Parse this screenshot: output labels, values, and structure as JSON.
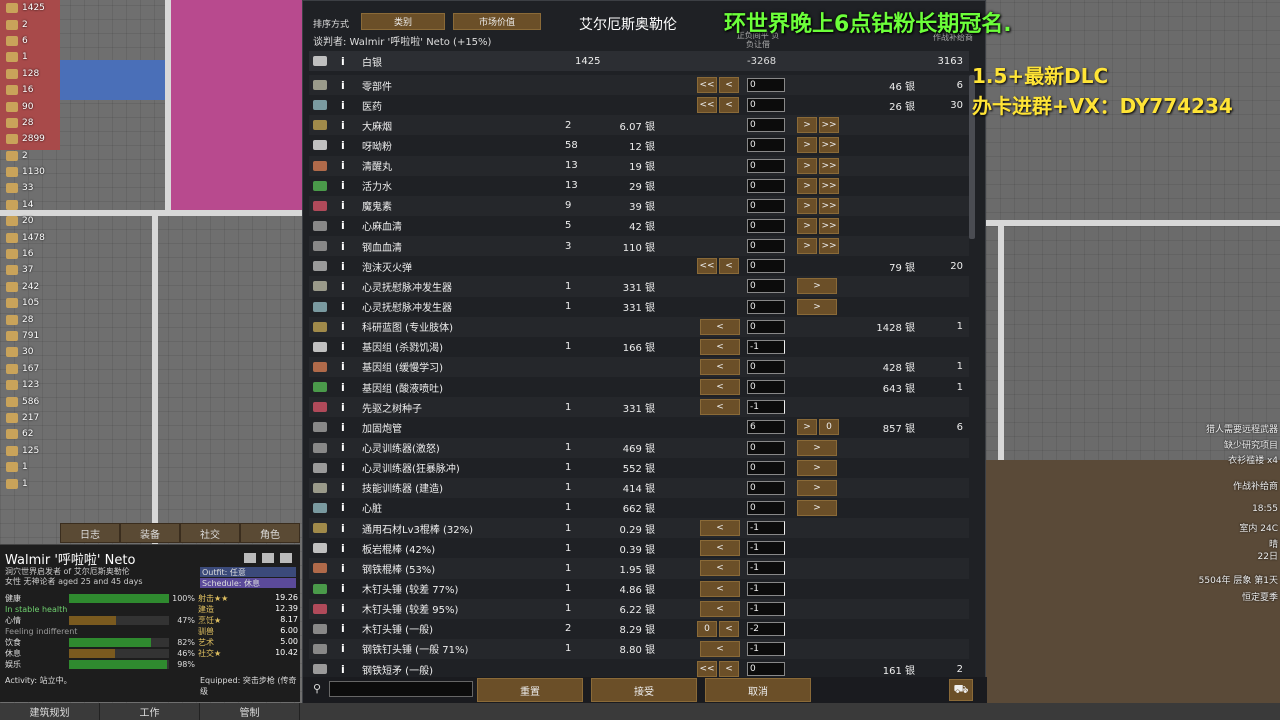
{
  "overlay": {
    "title": "环世界晚上6点钻粉长期冠名.",
    "line1": "1.5+最新DLC",
    "line2": "办卡进群+VX：DY774234"
  },
  "resources": [
    "1425",
    "2",
    "6",
    "1",
    "128",
    "16",
    "90",
    "28",
    "2899",
    "2",
    "1130",
    "33",
    "14",
    "20",
    "1478",
    "16",
    "37",
    "242",
    "105",
    "28",
    "791",
    "30",
    "167",
    "123",
    "586",
    "217",
    "62",
    "125",
    "1",
    "1"
  ],
  "dialog": {
    "sort_label": "排序方式",
    "sort_btn_1": "类别",
    "sort_btn_2": "市场价值",
    "trader_title": "艾尔厄斯奥勒伦",
    "negotiator": "谈判者: Walmir '呼啦啦' Neto (+15%)",
    "col_head_1": "正负间平 负负让借",
    "col_head_2": "作战补给商",
    "silver": {
      "name": "白银",
      "count": "1425",
      "offer": "-3268",
      "trader": "3163"
    },
    "rows": [
      {
        "name": "零部件",
        "count": "",
        "price": "",
        "lbtns": [
          "<<",
          "<"
        ],
        "input": "0",
        "neg": false,
        "rbtns": [],
        "tprice": "46 银",
        "tcount": "6"
      },
      {
        "name": "医药",
        "count": "",
        "price": "",
        "lbtns": [
          "<<",
          "<"
        ],
        "input": "0",
        "neg": false,
        "rbtns": [],
        "tprice": "26 银",
        "tcount": "30"
      },
      {
        "name": "大麻烟",
        "count": "2",
        "price": "6.07 银",
        "lbtns": [],
        "input": "0",
        "neg": false,
        "rbtns": [
          ">",
          ">>"
        ],
        "tprice": "",
        "tcount": ""
      },
      {
        "name": "呀呦粉",
        "count": "58",
        "price": "12 银",
        "lbtns": [],
        "input": "0",
        "neg": false,
        "rbtns": [
          ">",
          ">>"
        ],
        "tprice": "",
        "tcount": ""
      },
      {
        "name": "清醒丸",
        "count": "13",
        "price": "19 银",
        "lbtns": [],
        "input": "0",
        "neg": false,
        "rbtns": [
          ">",
          ">>"
        ],
        "tprice": "",
        "tcount": ""
      },
      {
        "name": "活力水",
        "count": "13",
        "price": "29 银",
        "lbtns": [],
        "input": "0",
        "neg": false,
        "rbtns": [
          ">",
          ">>"
        ],
        "tprice": "",
        "tcount": ""
      },
      {
        "name": "魔鬼素",
        "count": "9",
        "price": "39 银",
        "lbtns": [],
        "input": "0",
        "neg": false,
        "rbtns": [
          ">",
          ">>"
        ],
        "tprice": "",
        "tcount": ""
      },
      {
        "name": "心麻血清",
        "count": "5",
        "price": "42 银",
        "lbtns": [],
        "input": "0",
        "neg": false,
        "rbtns": [
          ">",
          ">>"
        ],
        "tprice": "",
        "tcount": ""
      },
      {
        "name": "钢血血清",
        "count": "3",
        "price": "110 银",
        "lbtns": [],
        "input": "0",
        "neg": false,
        "rbtns": [
          ">",
          ">>"
        ],
        "tprice": "",
        "tcount": ""
      },
      {
        "name": "泡沫灭火弹",
        "count": "",
        "price": "",
        "lbtns": [
          "<<",
          "<"
        ],
        "input": "0",
        "neg": false,
        "rbtns": [],
        "tprice": "79 银",
        "tcount": "20"
      },
      {
        "name": "心灵抚慰脉冲发生器",
        "count": "1",
        "price": "331 银",
        "lbtns": [],
        "input": "0",
        "neg": false,
        "rbtns": [
          ">"
        ],
        "tprice": "",
        "tcount": ""
      },
      {
        "name": "心灵抚慰脉冲发生器",
        "count": "1",
        "price": "331 银",
        "lbtns": [],
        "input": "0",
        "neg": false,
        "rbtns": [
          ">"
        ],
        "tprice": "",
        "tcount": ""
      },
      {
        "name": "科研蓝图 (专业肢体)",
        "count": "",
        "price": "",
        "lbtns": [
          "<"
        ],
        "input": "0",
        "neg": false,
        "rbtns": [],
        "tprice": "1428 银",
        "tcount": "1"
      },
      {
        "name": "基因组 (杀戮饥渴)",
        "count": "1",
        "price": "166 银",
        "lbtns": [
          "<"
        ],
        "input": "-1",
        "neg": true,
        "rbtns": [],
        "tprice": "",
        "tcount": ""
      },
      {
        "name": "基因组 (缓慢学习)",
        "count": "",
        "price": "",
        "lbtns": [
          "<"
        ],
        "input": "0",
        "neg": false,
        "rbtns": [],
        "tprice": "428 银",
        "tcount": "1"
      },
      {
        "name": "基因组 (酸液喷吐)",
        "count": "",
        "price": "",
        "lbtns": [
          "<"
        ],
        "input": "0",
        "neg": false,
        "rbtns": [],
        "tprice": "643 银",
        "tcount": "1"
      },
      {
        "name": "先驱之树种子",
        "count": "1",
        "price": "331 银",
        "lbtns": [
          "<"
        ],
        "input": "-1",
        "neg": true,
        "rbtns": [],
        "tprice": "",
        "tcount": ""
      },
      {
        "name": "加固炮管",
        "count": "",
        "price": "",
        "lbtns": [],
        "input": "6",
        "neg": false,
        "rbtns": [
          ">",
          "0"
        ],
        "tprice": "857 银",
        "tcount": "6"
      },
      {
        "name": "心灵训练器(激怒)",
        "count": "1",
        "price": "469 银",
        "lbtns": [],
        "input": "0",
        "neg": false,
        "rbtns": [
          ">"
        ],
        "tprice": "",
        "tcount": ""
      },
      {
        "name": "心灵训练器(狂暴脉冲)",
        "count": "1",
        "price": "552 银",
        "lbtns": [],
        "input": "0",
        "neg": false,
        "rbtns": [
          ">"
        ],
        "tprice": "",
        "tcount": ""
      },
      {
        "name": "技能训练器 (建造)",
        "count": "1",
        "price": "414 银",
        "lbtns": [],
        "input": "0",
        "neg": false,
        "rbtns": [
          ">"
        ],
        "tprice": "",
        "tcount": ""
      },
      {
        "name": "心脏",
        "count": "1",
        "price": "662 银",
        "lbtns": [],
        "input": "0",
        "neg": false,
        "rbtns": [
          ">"
        ],
        "tprice": "",
        "tcount": ""
      },
      {
        "name": "通用石材Lv3棍棒 (32%)",
        "count": "1",
        "price": "0.29 银",
        "lbtns": [
          "<"
        ],
        "input": "-1",
        "neg": true,
        "rbtns": [],
        "tprice": "",
        "tcount": ""
      },
      {
        "name": "板岩棍棒 (42%)",
        "count": "1",
        "price": "0.39 银",
        "lbtns": [
          "<"
        ],
        "input": "-1",
        "neg": true,
        "rbtns": [],
        "tprice": "",
        "tcount": ""
      },
      {
        "name": "钢铁棍棒 (53%)",
        "count": "1",
        "price": "1.95 银",
        "lbtns": [
          "<"
        ],
        "input": "-1",
        "neg": true,
        "rbtns": [],
        "tprice": "",
        "tcount": ""
      },
      {
        "name": "木钉头锤 (较差 77%)",
        "count": "1",
        "price": "4.86 银",
        "lbtns": [
          "<"
        ],
        "input": "-1",
        "neg": true,
        "rbtns": [],
        "tprice": "",
        "tcount": ""
      },
      {
        "name": "木钉头锤 (较差 95%)",
        "count": "1",
        "price": "6.22 银",
        "lbtns": [
          "<"
        ],
        "input": "-1",
        "neg": true,
        "rbtns": [],
        "tprice": "",
        "tcount": ""
      },
      {
        "name": "木钉头锤 (一般)",
        "count": "2",
        "price": "8.29 银",
        "lbtns": [
          "0",
          "<"
        ],
        "input": "-2",
        "neg": true,
        "rbtns": [],
        "tprice": "",
        "tcount": ""
      },
      {
        "name": "钢铁钉头锤 (一般 71%)",
        "count": "1",
        "price": "8.80 银",
        "lbtns": [
          "<"
        ],
        "input": "-1",
        "neg": true,
        "rbtns": [],
        "tprice": "",
        "tcount": ""
      },
      {
        "name": "钢铁短矛 (一般)",
        "count": "",
        "price": "",
        "lbtns": [
          "<<",
          "<"
        ],
        "input": "0",
        "neg": false,
        "rbtns": [],
        "tprice": "161 银",
        "tcount": "2"
      }
    ],
    "footer": {
      "reset": "重置",
      "accept": "接受",
      "cancel": "取消"
    }
  },
  "tabs": [
    "日志",
    "装备",
    "社交",
    "角色"
  ],
  "character": {
    "name": "Walmir '呼啦啦' Neto",
    "sub1": "洞穴世界启发者 of 艾尔厄斯奥勒伦",
    "sub2": "女性 无神论者 aged 25 and 45 days",
    "outfit": "Outfit: 任意",
    "schedule": "Schedule: 休息",
    "needs": [
      {
        "label": "健康",
        "pct": "100%",
        "fill": 1.0,
        "type": "bar"
      },
      {
        "label": "In stable health",
        "type": "plain"
      },
      {
        "label": "心情",
        "pct": "47%",
        "fill": 0.47,
        "type": "bar"
      },
      {
        "label": "Feeling indifferent",
        "type": "grey"
      },
      {
        "label": "饮食",
        "pct": "82%",
        "fill": 0.82,
        "type": "bar"
      },
      {
        "label": "休息",
        "pct": "46%",
        "fill": 0.46,
        "type": "bar"
      },
      {
        "label": "娱乐",
        "pct": "98%",
        "fill": 0.98,
        "type": "bar"
      }
    ],
    "skills": [
      {
        "label": "射击★★",
        "value": "19.26"
      },
      {
        "label": "建造",
        "value": "12.39"
      },
      {
        "label": "烹饪★",
        "value": "8.17"
      },
      {
        "label": "驯兽",
        "value": "6.00"
      },
      {
        "label": "艺术",
        "value": "5.00"
      },
      {
        "label": "社交★",
        "value": "10.42"
      }
    ],
    "activity": "Activity: 站立中。",
    "equipped": "Equipped: 突击步枪 (传奇级"
  },
  "bottombar": [
    "建筑规划",
    "工作",
    "管制"
  ],
  "right_info": [
    "猎人需要远程武器",
    "缺少研究项目",
    "衣衫褴褛 x4",
    "作战补给商",
    "18:55",
    "室内 24C",
    "晴",
    "22日",
    "5504年 层象 第1天",
    "恒定夏季"
  ]
}
